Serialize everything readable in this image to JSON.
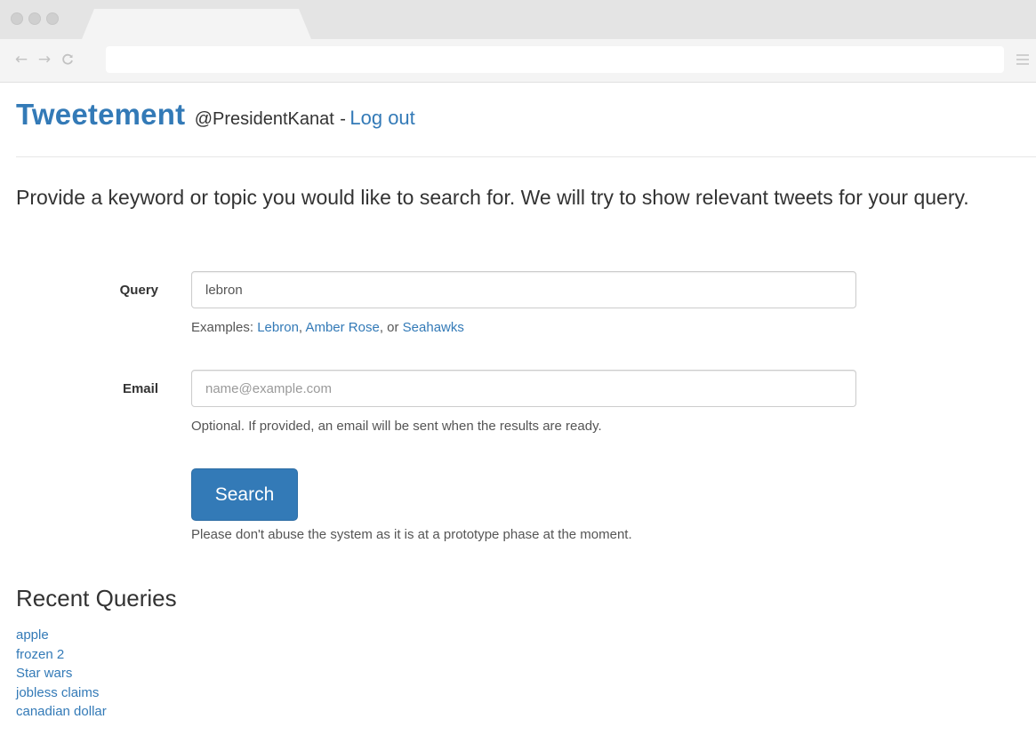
{
  "app": {
    "brand": "Tweetement",
    "username": "@PresidentKanat",
    "separator": "-",
    "logout_label": "Log out"
  },
  "browser": {
    "back_icon": "back-arrow-icon",
    "forward_icon": "forward-arrow-icon",
    "reload_icon": "reload-icon",
    "menu_icon": "hamburger-menu-icon"
  },
  "intro": "Provide a keyword or topic you would like to search for. We will try to show relevant tweets for your query.",
  "form": {
    "query": {
      "label": "Query",
      "value": "lebron",
      "examples_prefix": "Examples:",
      "examples": [
        "Lebron",
        "Amber Rose",
        "Seahawks"
      ],
      "examples_sep1": ",",
      "examples_sep2": ", or"
    },
    "email": {
      "label": "Email",
      "value": "",
      "placeholder": "name@example.com",
      "help": "Optional. If provided, an email will be sent when the results are ready."
    },
    "submit_label": "Search",
    "notice": "Please don't abuse the system as it is at a prototype phase at the moment."
  },
  "recent": {
    "title": "Recent Queries",
    "items": [
      "apple",
      "frozen 2",
      "Star wars",
      "jobless claims",
      "canadian dollar"
    ]
  },
  "colors": {
    "accent": "#337ab7",
    "text": "#333333",
    "muted": "#555555"
  }
}
